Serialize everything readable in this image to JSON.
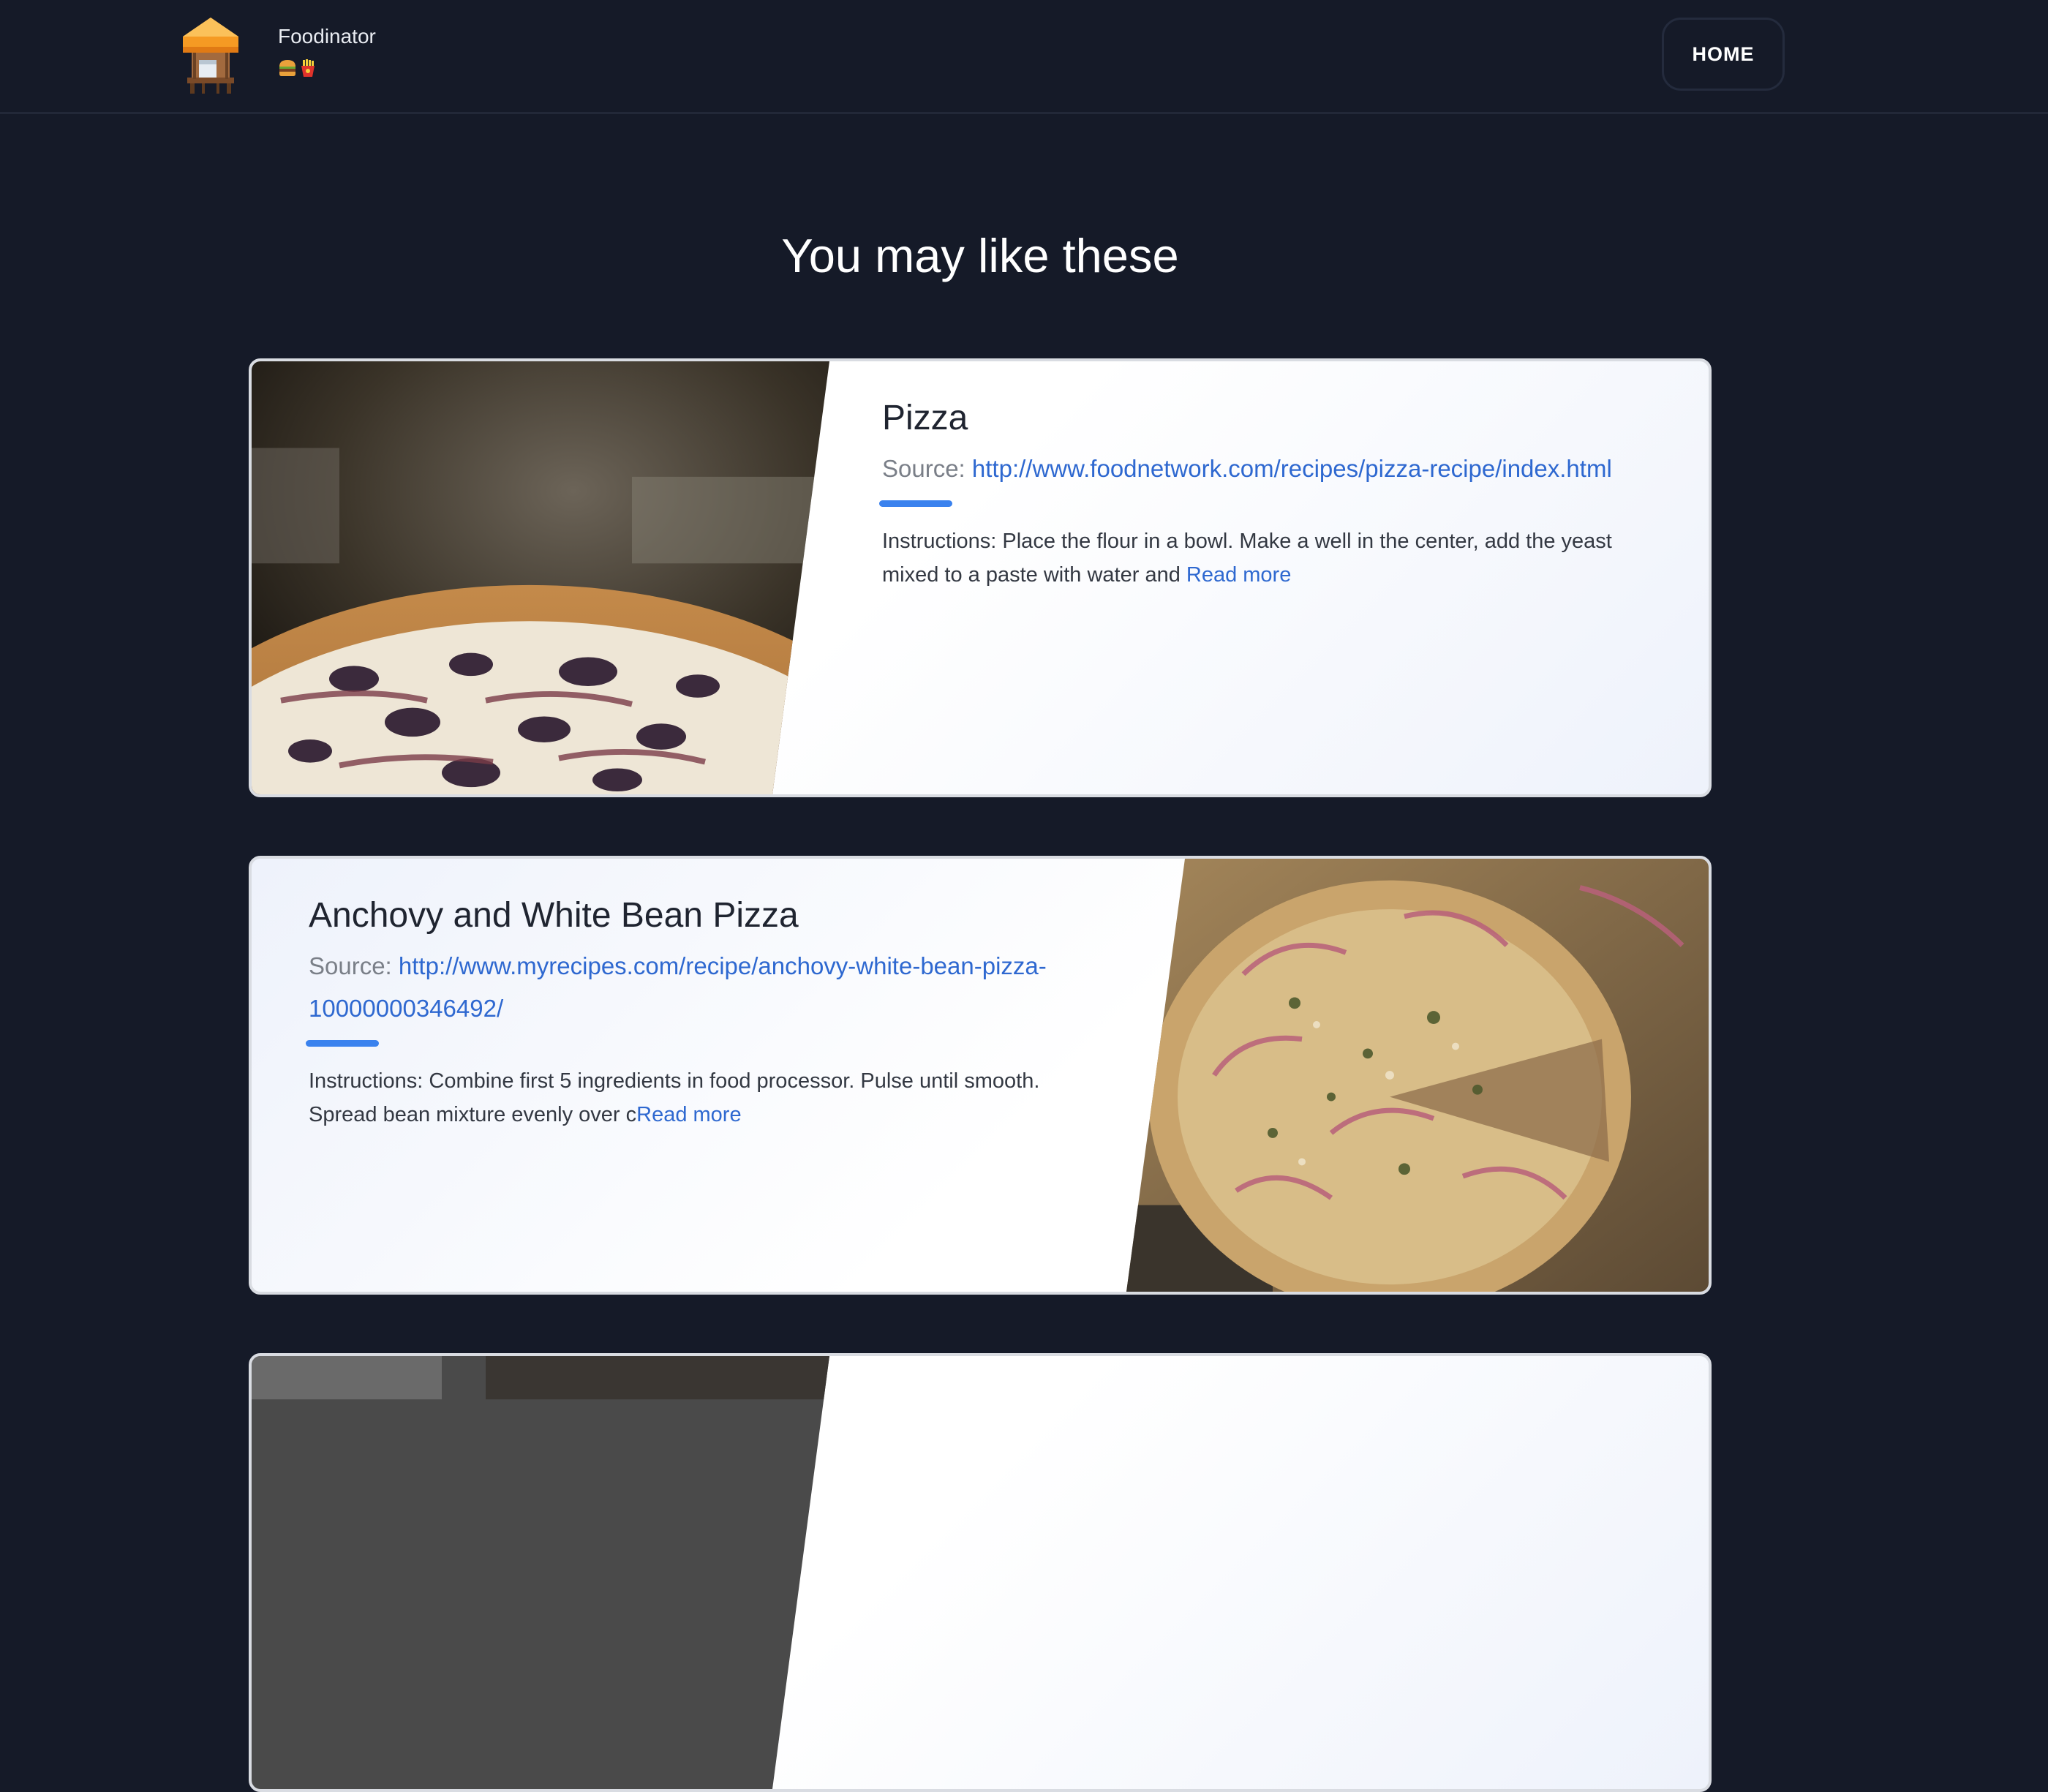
{
  "header": {
    "brand_name": "Foodinator",
    "brand_emojis": [
      "burger-icon",
      "fries-icon"
    ],
    "home_label": "HOME"
  },
  "main": {
    "heading": "You may like these"
  },
  "recipes": [
    {
      "title": "Pizza",
      "source_label": "Source: ",
      "source_url": "http://www.foodnetwork.com/recipes/pizza-recipe/index.html",
      "instructions": "Instructions: Place the flour in a bowl. Make a well in the center, add the yeast mixed to a paste with water and ",
      "read_more": "Read more"
    },
    {
      "title": "Anchovy and White Bean Pizza",
      "source_label": "Source: ",
      "source_url": "http://www.myrecipes.com/recipe/anchovy-white-bean-pizza-10000000346492/",
      "instructions": "Instructions: Combine first 5 ingredients in food processor. Pulse until smooth. Spread bean mixture evenly over c",
      "read_more": "Read more"
    }
  ],
  "colors": {
    "page_background": "#151a28",
    "link": "#2e68d0",
    "accent_bar": "#3a82ee"
  }
}
